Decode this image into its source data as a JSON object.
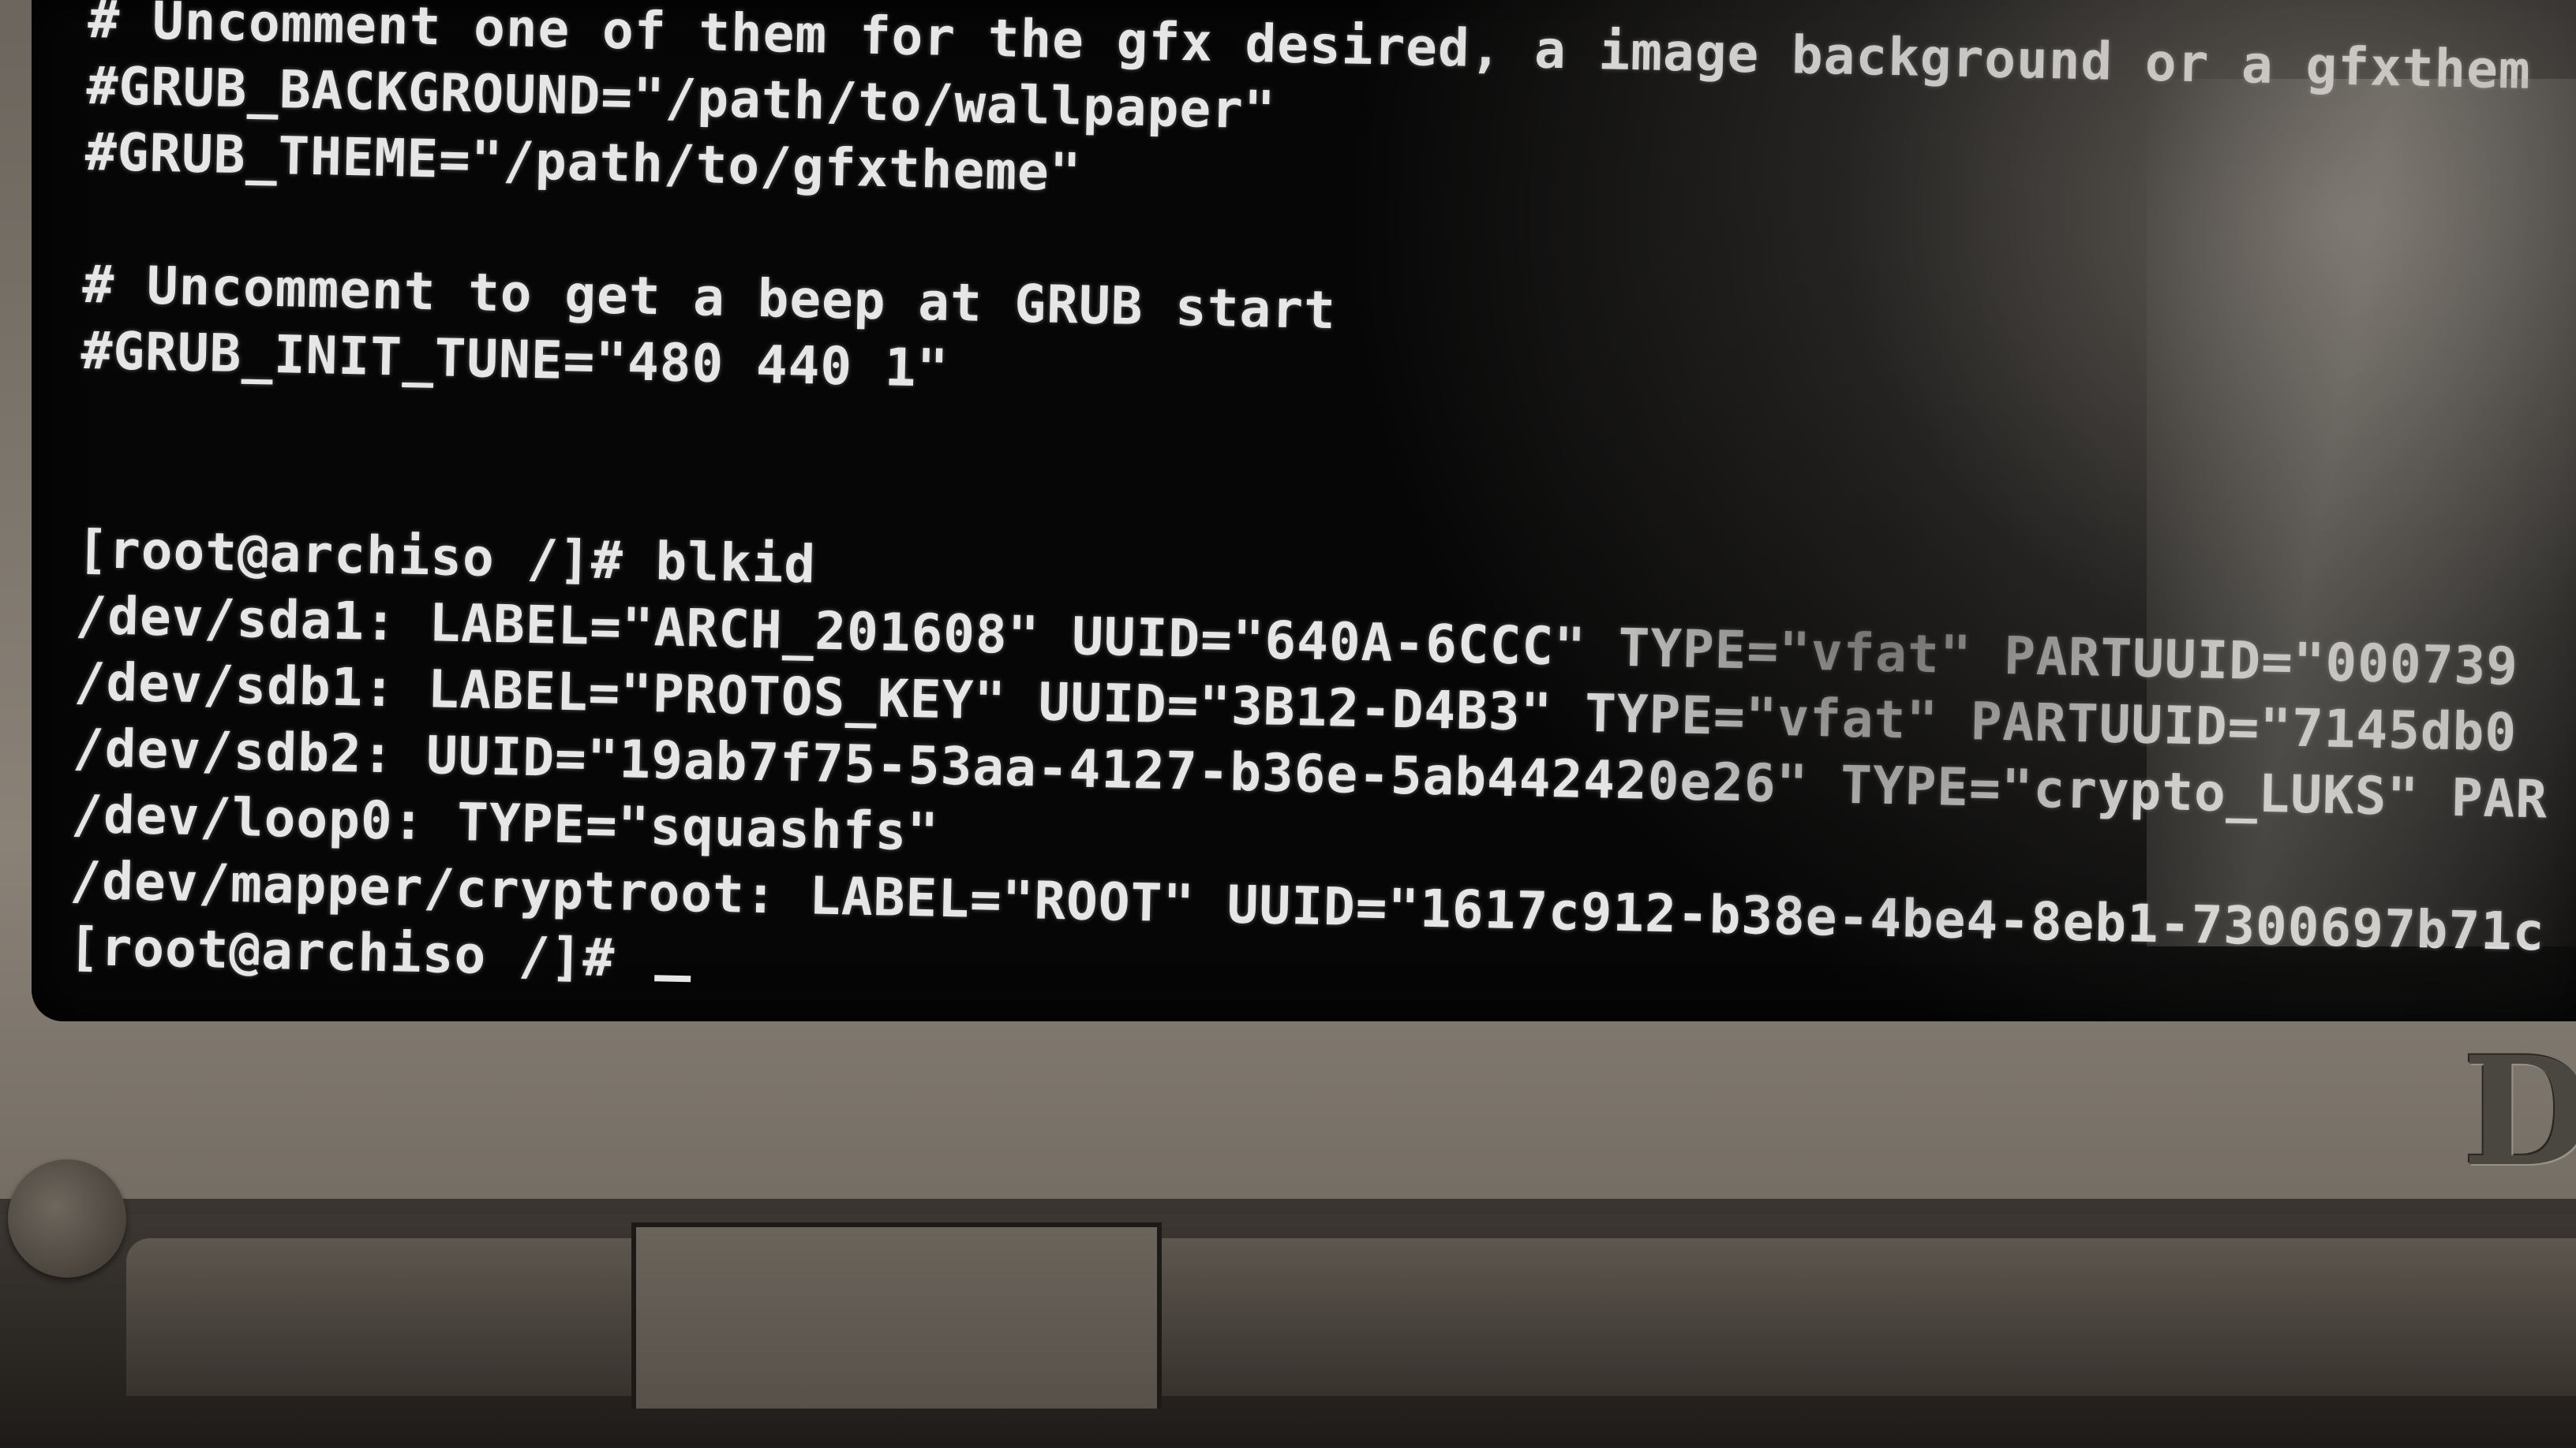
{
  "terminal": {
    "lines": [
      "# Uncomment one of them for the gfx desired, a image background or a gfxthem",
      "#GRUB_BACKGROUND=\"/path/to/wallpaper\"",
      "#GRUB_THEME=\"/path/to/gfxtheme\"",
      "",
      "# Uncomment to get a beep at GRUB start",
      "#GRUB_INIT_TUNE=\"480 440 1\"",
      "",
      "",
      "[root@archiso /]# blkid",
      "/dev/sda1: LABEL=\"ARCH_201608\" UUID=\"640A-6CCC\" TYPE=\"vfat\" PARTUUID=\"000739",
      "/dev/sdb1: LABEL=\"PROTOS_KEY\" UUID=\"3B12-D4B3\" TYPE=\"vfat\" PARTUUID=\"7145db0",
      "/dev/sdb2: UUID=\"19ab7f75-53aa-4127-b36e-5ab442420e26\" TYPE=\"crypto_LUKS\" PAR",
      "/dev/loop0: TYPE=\"squashfs\"",
      "/dev/mapper/cryptroot: LABEL=\"ROOT\" UUID=\"1617c912-b38e-4be4-8eb1-7300697b71c",
      "[root@archiso /]# "
    ]
  },
  "bezel": {
    "logo_text": "D"
  }
}
